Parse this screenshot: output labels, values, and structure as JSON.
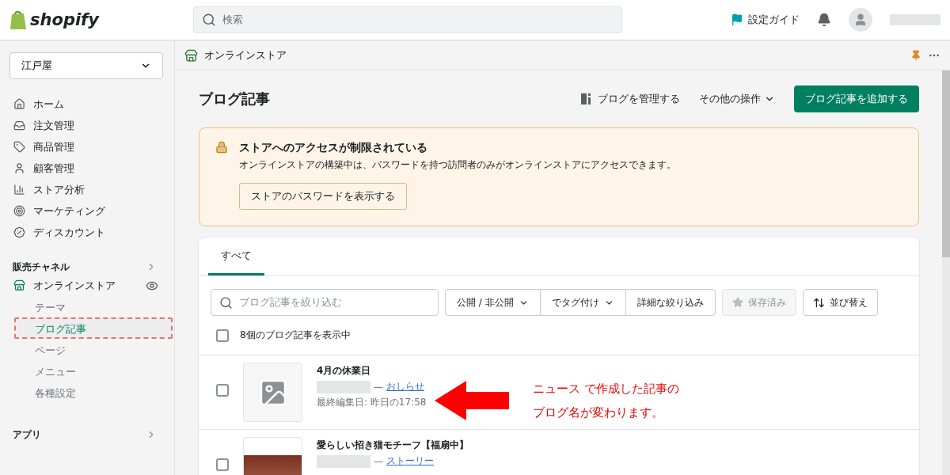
{
  "topbar": {
    "logo": "shopify",
    "search": {
      "placeholder": "検索"
    },
    "guide": "設定ガイド"
  },
  "sidebar": {
    "store": "江戸屋",
    "items": [
      {
        "label": "ホーム",
        "kind": "home"
      },
      {
        "label": "注文管理",
        "kind": "orders"
      },
      {
        "label": "商品管理",
        "kind": "products"
      },
      {
        "label": "顧客管理",
        "kind": "customers"
      },
      {
        "label": "ストア分析",
        "kind": "analytics"
      },
      {
        "label": "マーケティング",
        "kind": "marketing"
      },
      {
        "label": "ディスカウント",
        "kind": "discounts"
      }
    ],
    "channels_heading": "販売チャネル",
    "channel": {
      "label": "オンラインストア",
      "children": [
        {
          "label": "テーマ",
          "selected": false
        },
        {
          "label": "ブログ記事",
          "selected": true
        },
        {
          "label": "ページ",
          "selected": false
        },
        {
          "label": "メニュー",
          "selected": false
        },
        {
          "label": "各種設定",
          "selected": false
        }
      ]
    },
    "apps_heading": "アプリ"
  },
  "breadcrumb": "オンラインストア",
  "page": {
    "title": "ブログ記事",
    "manage": "ブログを管理する",
    "more": "その他の操作",
    "primary": "ブログ記事を追加する"
  },
  "banner": {
    "title": "ストアへのアクセスが制限されている",
    "text": "オンラインストアの構築中は、パスワードを持つ訪問者のみがオンラインストアにアクセスできます。",
    "button": "ストアのパスワードを表示する"
  },
  "card": {
    "tabs": [
      {
        "label": "すべて",
        "selected": true
      }
    ],
    "search": {
      "placeholder": "ブログ記事を絞り込む"
    },
    "filters": [
      {
        "label": "公開 / 非公開",
        "kind": "dropdown"
      },
      {
        "label": "でタグ付け",
        "kind": "dropdown"
      },
      {
        "label": "詳細な絞り込み",
        "kind": "plain"
      }
    ],
    "saved": {
      "label": "保存済み",
      "disabled": true
    },
    "sort": "並び替え",
    "select_all_checked": false,
    "count": "8個のブログ記事を表示中",
    "rows": [
      {
        "title": "4月の休業日",
        "separator": "—",
        "blog": "おしらせ",
        "edited": "最終編集日: 昨日の17:58",
        "kind": "placeholder",
        "checked": false
      },
      {
        "title": "愛らしい招き猫モチーフ【福扇中】",
        "separator": "—",
        "blog": "ストーリー",
        "kind": "photo",
        "checked": false
      }
    ]
  },
  "annotation": {
    "lines": [
      "ニュース で作成した記事の",
      "ブログ名が変わります。"
    ]
  }
}
